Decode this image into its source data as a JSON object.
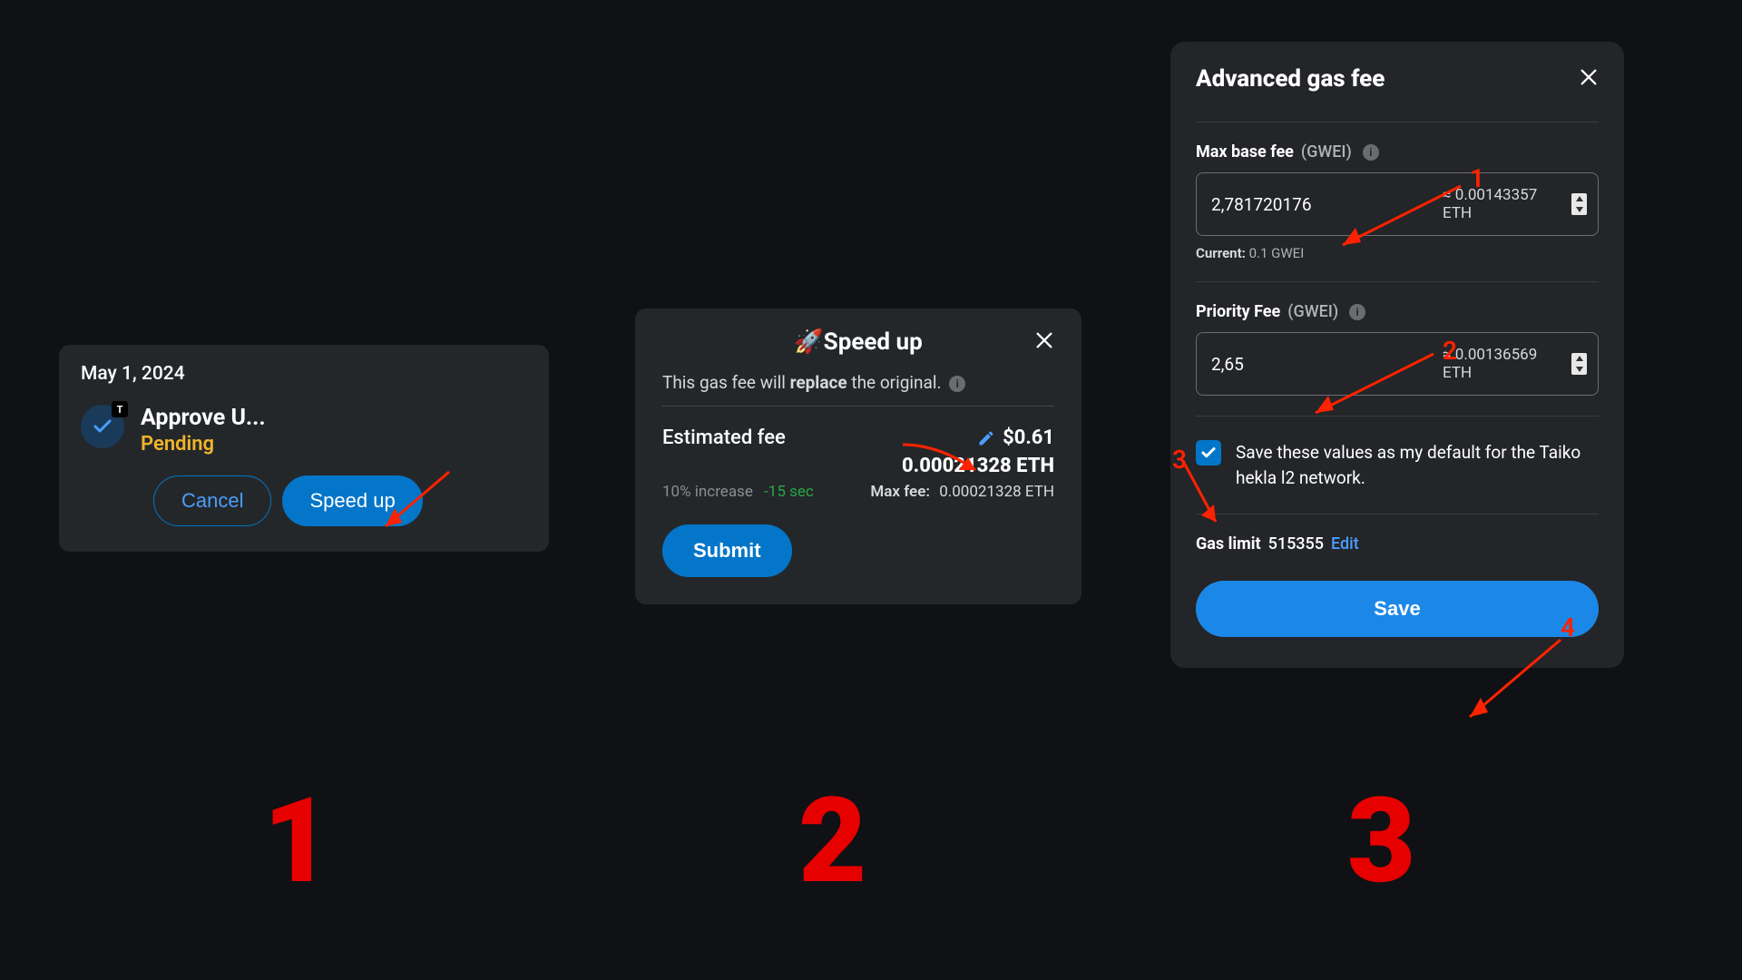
{
  "panel1": {
    "date": "May 1, 2024",
    "badge": "T",
    "title": "Approve U...",
    "status": "Pending",
    "cancel": "Cancel",
    "speedup": "Speed up"
  },
  "panel2": {
    "title": "🚀Speed up",
    "subtitle_pre": "This gas fee will ",
    "subtitle_bold": "replace",
    "subtitle_post": " the original.",
    "est_label": "Estimated fee",
    "usd": "$0.61",
    "eth": "0.00021328 ETH",
    "increase": "10% increase",
    "time": "-15 sec",
    "maxfee_label": "Max fee:",
    "maxfee_val": "0.00021328 ETH",
    "submit": "Submit"
  },
  "panel3": {
    "title": "Advanced gas fee",
    "maxbase_label": "Max base fee",
    "unit": "(GWEI)",
    "maxbase_val": "2,781720176",
    "maxbase_approx": "≈ 0.00143357 ETH",
    "current_label": "Current:",
    "current_val": "0.1 GWEI",
    "priority_label": "Priority Fee",
    "priority_val": "2,65",
    "priority_approx": "≈ 0.00136569 ETH",
    "save_default": "Save these values as my default for the Taiko hekla l2 network.",
    "gaslimit_label": "Gas limit",
    "gaslimit_val": "515355",
    "edit": "Edit",
    "save": "Save"
  },
  "big": {
    "n1": "1",
    "n2": "2",
    "n3": "3"
  },
  "anno": {
    "n1": "1",
    "n2": "2",
    "n3": "3",
    "n4": "4"
  }
}
